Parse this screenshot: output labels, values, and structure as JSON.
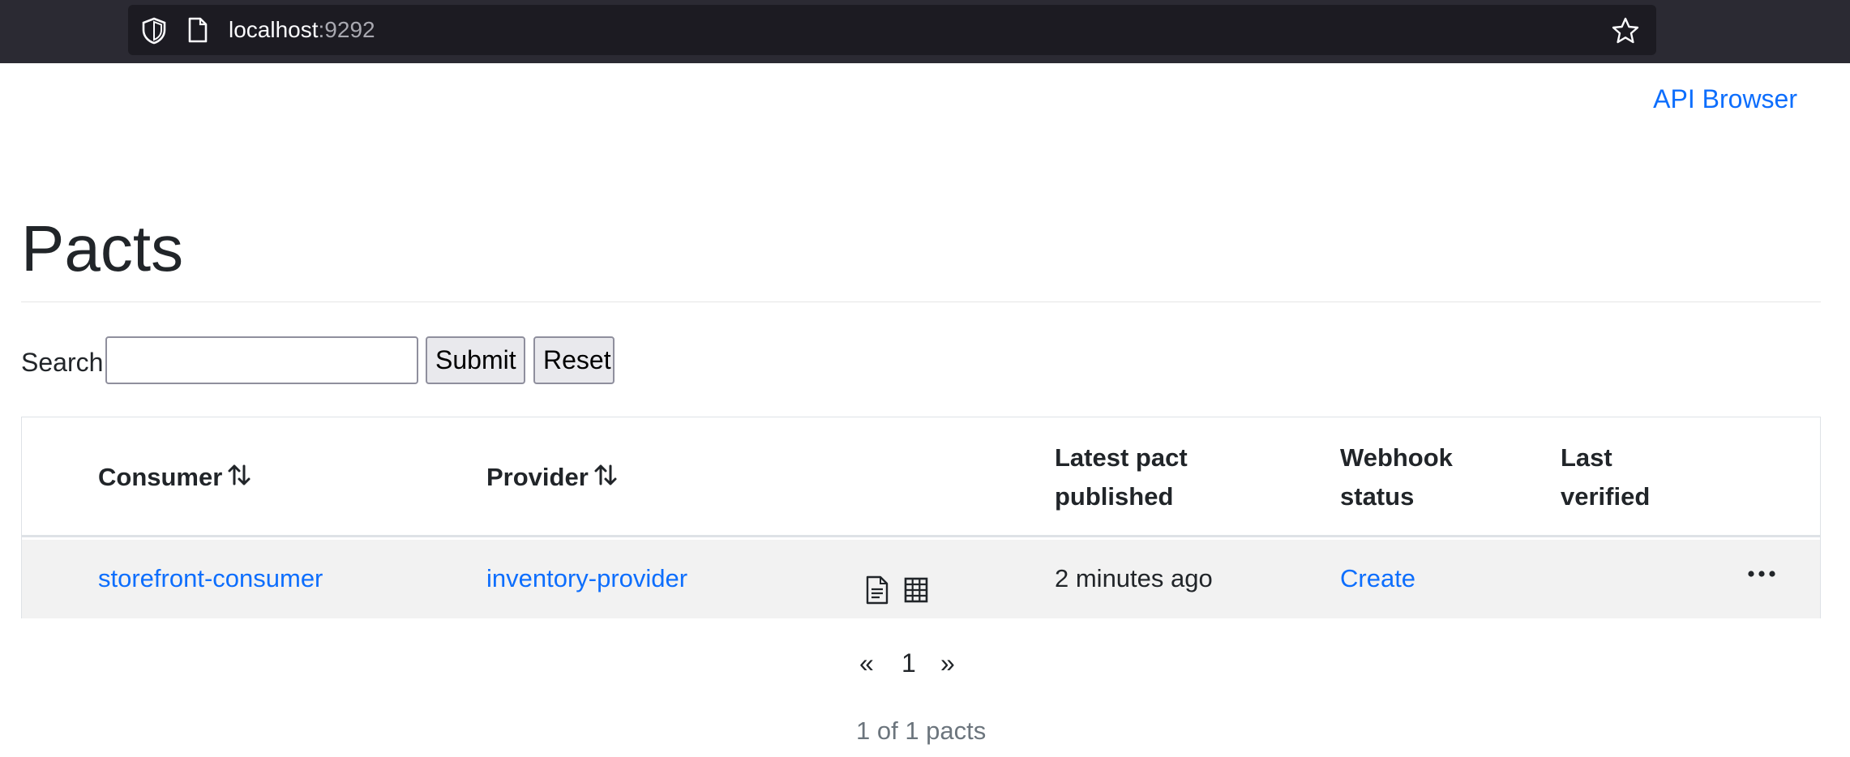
{
  "browser": {
    "url_host": "localhost",
    "url_port": ":9292",
    "icons": [
      "shield-icon",
      "page-icon",
      "star-icon"
    ]
  },
  "header": {
    "api_browser_link": "API Browser"
  },
  "page": {
    "title": "Pacts"
  },
  "search": {
    "label": "Search",
    "value": "",
    "placeholder": "",
    "submit_label": "Submit",
    "reset_label": "Reset"
  },
  "table": {
    "columns": {
      "consumer": "Consumer",
      "provider": "Provider",
      "latest_line1": "Latest pact",
      "latest_line2": "published",
      "webhook_line1": "Webhook",
      "webhook_line2": "status",
      "verified_line1": "Last",
      "verified_line2": "verified"
    },
    "rows": [
      {
        "consumer": "storefront-consumer",
        "provider": "inventory-provider",
        "published": "2 minutes ago",
        "webhook_status": "Create",
        "last_verified": "",
        "actions": "..."
      }
    ]
  },
  "pagination": {
    "prev": "«",
    "current": "1",
    "next": "»",
    "summary": "1 of 1 pacts"
  },
  "colors": {
    "link": "#0d6efd",
    "row_bg": "#f2f2f2",
    "chrome_bg": "#2b2a33"
  }
}
